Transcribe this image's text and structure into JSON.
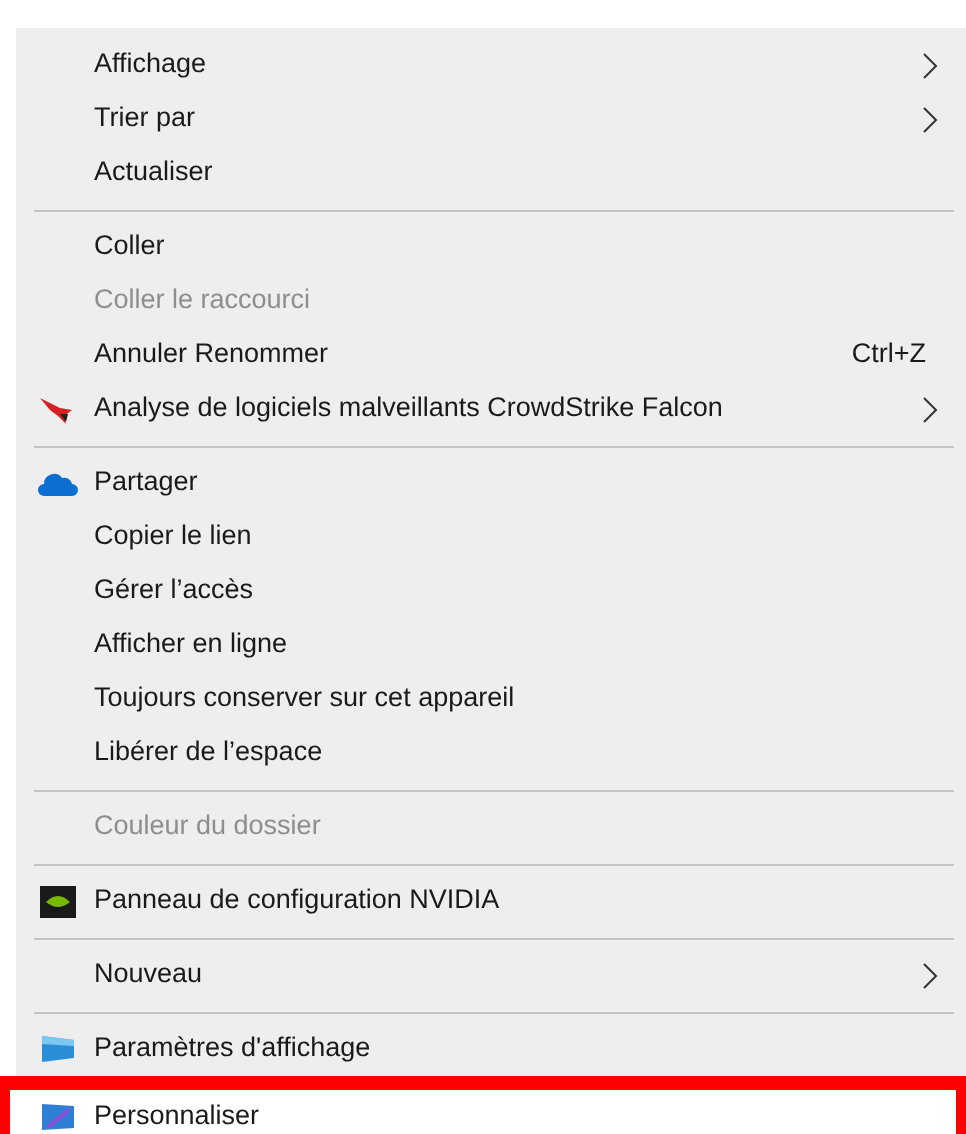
{
  "menu": {
    "sections": [
      {
        "items": [
          {
            "kind": "plain",
            "label": "Affichage",
            "submenu": true,
            "disabled": false
          },
          {
            "kind": "plain",
            "label": "Trier par",
            "submenu": true,
            "disabled": false
          },
          {
            "kind": "plain",
            "label": "Actualiser",
            "submenu": false,
            "disabled": false
          }
        ]
      },
      {
        "items": [
          {
            "kind": "plain",
            "label": "Coller",
            "submenu": false,
            "disabled": false
          },
          {
            "kind": "plain",
            "label": "Coller le raccourci",
            "submenu": false,
            "disabled": true
          },
          {
            "kind": "plain",
            "label": "Annuler Renommer",
            "shortcut": "Ctrl+Z",
            "submenu": false,
            "disabled": false
          },
          {
            "kind": "falcon",
            "label": "Analyse de logiciels malveillants CrowdStrike Falcon",
            "submenu": true,
            "disabled": false
          }
        ]
      },
      {
        "items": [
          {
            "kind": "cloud",
            "label": "Partager",
            "submenu": false,
            "disabled": false
          },
          {
            "kind": "plain",
            "label": "Copier le lien",
            "submenu": false,
            "disabled": false
          },
          {
            "kind": "plain",
            "label": "Gérer l’accès",
            "submenu": false,
            "disabled": false
          },
          {
            "kind": "plain",
            "label": "Afficher en ligne",
            "submenu": false,
            "disabled": false
          },
          {
            "kind": "plain",
            "label": "Toujours conserver sur cet appareil",
            "submenu": false,
            "disabled": false
          },
          {
            "kind": "plain",
            "label": "Libérer de l’espace",
            "submenu": false,
            "disabled": false
          }
        ]
      },
      {
        "items": [
          {
            "kind": "plain",
            "label": "Couleur du dossier",
            "submenu": false,
            "disabled": true
          }
        ]
      },
      {
        "items": [
          {
            "kind": "nvidia",
            "label": "Panneau de configuration NVIDIA",
            "submenu": false,
            "disabled": false
          }
        ]
      },
      {
        "items": [
          {
            "kind": "plain",
            "label": "Nouveau",
            "submenu": true,
            "disabled": false
          }
        ]
      },
      {
        "items": [
          {
            "kind": "display",
            "label": "Paramètres d'affichage",
            "submenu": false,
            "disabled": false,
            "highlighted": false
          },
          {
            "kind": "personalize",
            "label": "Personnaliser",
            "submenu": false,
            "disabled": false,
            "highlighted": true
          }
        ]
      }
    ]
  }
}
